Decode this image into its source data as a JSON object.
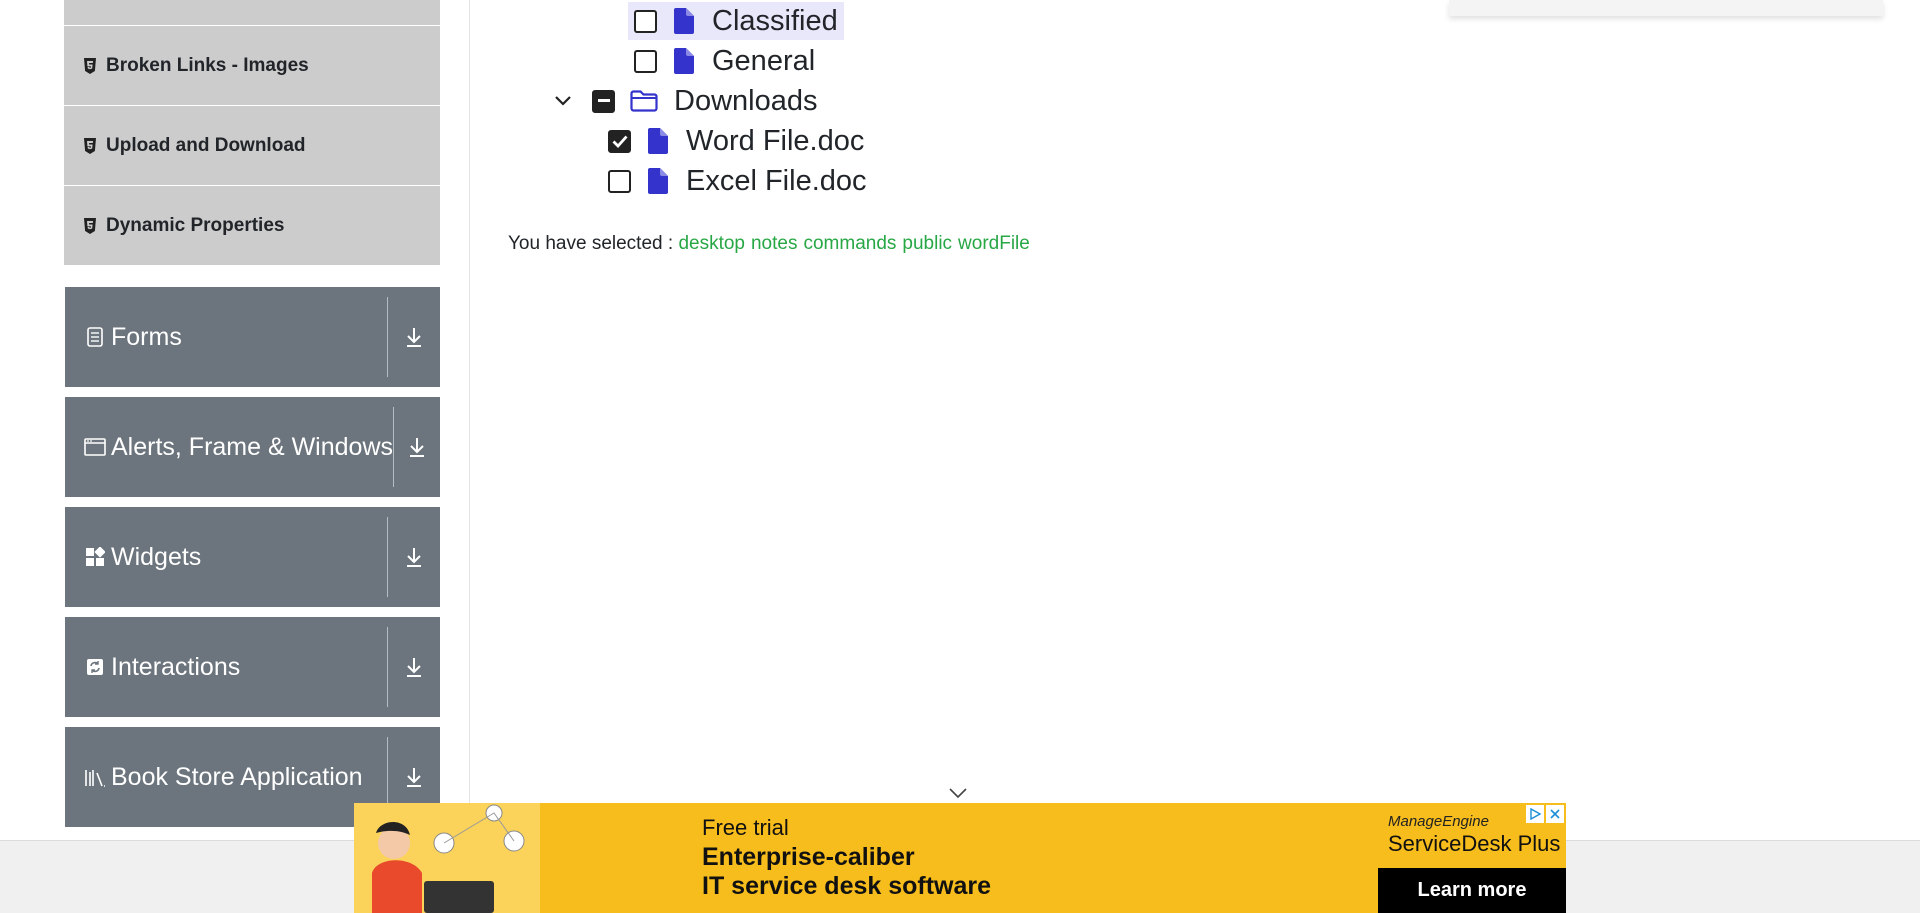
{
  "sidebar": {
    "sub_items": [
      {
        "label": ""
      },
      {
        "label": "Broken Links - Images"
      },
      {
        "label": "Upload and Download"
      },
      {
        "label": "Dynamic Properties"
      }
    ],
    "groups": [
      {
        "label": "Forms",
        "icon": "form-icon"
      },
      {
        "label": "Alerts, Frame & Windows",
        "icon": "window-icon"
      },
      {
        "label": "Widgets",
        "icon": "widgets-icon"
      },
      {
        "label": "Interactions",
        "icon": "interactions-icon"
      },
      {
        "label": "Book Store Application",
        "icon": "books-icon"
      }
    ]
  },
  "tree": {
    "nodes": [
      {
        "label": "Classified",
        "type": "file",
        "state": "unchecked",
        "highlighted": true
      },
      {
        "label": "General",
        "type": "file",
        "state": "unchecked"
      },
      {
        "label": "Downloads",
        "type": "folder",
        "state": "half",
        "expanded": true
      },
      {
        "label": "Word File.doc",
        "type": "file",
        "state": "checked"
      },
      {
        "label": "Excel File.doc",
        "type": "file",
        "state": "unchecked"
      }
    ]
  },
  "result": {
    "prefix": "You have selected :",
    "items": [
      "desktop",
      "notes",
      "commands",
      "public",
      "wordFile"
    ]
  },
  "ad": {
    "free_trial": "Free trial",
    "headline_1": "Enterprise-caliber",
    "headline_2": "IT service desk software",
    "brand_top": "ManageEngine",
    "brand": "ServiceDesk Plus",
    "cta": "Learn more"
  },
  "colors": {
    "accent_green": "#28a745",
    "file_icon": "#3433cc",
    "group_bg": "#6c757d",
    "sub_bg": "#cccccc",
    "ad_bg": "#f7bd1c"
  }
}
